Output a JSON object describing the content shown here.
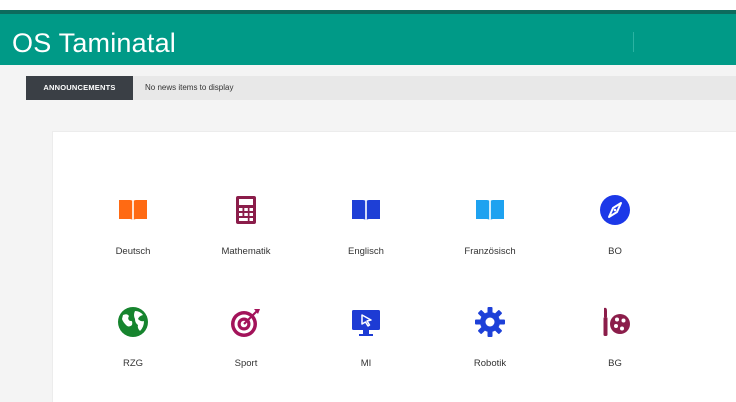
{
  "header": {
    "title": "OS Taminatal",
    "color": "#009a87"
  },
  "announcements": {
    "label": "ANNOUNCEMENTS",
    "text": "No news items to display"
  },
  "tiles": [
    {
      "label": "Deutsch",
      "icon": "book-open-icon",
      "color": "#ff6a13"
    },
    {
      "label": "Mathematik",
      "icon": "calculator-icon",
      "color": "#8b1d4a"
    },
    {
      "label": "Englisch",
      "icon": "book-open-icon",
      "color": "#1e3fd6"
    },
    {
      "label": "Französisch",
      "icon": "book-open-icon",
      "color": "#1ea2f0"
    },
    {
      "label": "BO",
      "icon": "compass-icon",
      "color": "#1c38e8"
    },
    {
      "label": "RZG",
      "icon": "globe-icon",
      "color": "#16842e"
    },
    {
      "label": "Sport",
      "icon": "target-icon",
      "color": "#a3135a"
    },
    {
      "label": "MI",
      "icon": "screen-cursor-icon",
      "color": "#1d3bd4"
    },
    {
      "label": "Robotik",
      "icon": "gear-icon",
      "color": "#1d40d8"
    },
    {
      "label": "BG",
      "icon": "palette-icon",
      "color": "#8b1d4a"
    }
  ]
}
